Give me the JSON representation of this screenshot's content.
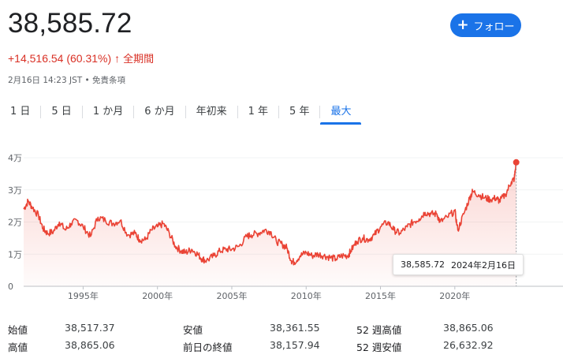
{
  "quote": {
    "price": "38,585.72",
    "change": "+14,516.54 (60.31%)",
    "change_arrow": "↑",
    "period": "全期間",
    "timestamp": "2月16日 14:23 JST • 免責条項",
    "follow_label": "フォロー",
    "follow_icon": "plus-icon"
  },
  "tabs": [
    {
      "label": "1 日",
      "active": false
    },
    {
      "label": "5 日",
      "active": false
    },
    {
      "label": "1 か月",
      "active": false
    },
    {
      "label": "6 か月",
      "active": false
    },
    {
      "label": "年初来",
      "active": false
    },
    {
      "label": "1 年",
      "active": false
    },
    {
      "label": "5 年",
      "active": false
    },
    {
      "label": "最大",
      "active": true
    }
  ],
  "tooltip": {
    "value": "38,585.72",
    "date": "2024年2月16日"
  },
  "chart_data": {
    "type": "area",
    "color": "#ea4335",
    "y_ticks": [
      {
        "value": 0,
        "label": "0"
      },
      {
        "value": 10000,
        "label": "1万"
      },
      {
        "value": 20000,
        "label": "2万"
      },
      {
        "value": 30000,
        "label": "3万"
      },
      {
        "value": 40000,
        "label": "4万"
      }
    ],
    "ylim": [
      0,
      40000
    ],
    "xlim": [
      1991.0,
      2024.2
    ],
    "x_ticks": [
      {
        "value": 1995,
        "label": "1995年"
      },
      {
        "value": 2000,
        "label": "2000年"
      },
      {
        "value": 2005,
        "label": "2005年"
      },
      {
        "value": 2010,
        "label": "2010年"
      },
      {
        "value": 2015,
        "label": "2015年"
      },
      {
        "value": 2020,
        "label": "2020年"
      }
    ],
    "x": [
      1991.0,
      1991.3,
      1991.6,
      1992.0,
      1992.3,
      1992.6,
      1993.0,
      1993.4,
      1993.8,
      1994.2,
      1994.6,
      1995.0,
      1995.5,
      1996.0,
      1996.5,
      1997.0,
      1997.5,
      1998.0,
      1998.5,
      1998.8,
      1999.2,
      1999.6,
      2000.0,
      2000.4,
      2000.8,
      2001.2,
      2001.6,
      2001.9,
      2002.3,
      2002.7,
      2003.0,
      2003.3,
      2003.8,
      2004.2,
      2004.6,
      2005.0,
      2005.5,
      2006.0,
      2006.3,
      2006.8,
      2007.2,
      2007.6,
      2008.0,
      2008.4,
      2008.7,
      2009.0,
      2009.2,
      2009.6,
      2010.0,
      2010.4,
      2010.8,
      2011.2,
      2011.6,
      2012.0,
      2012.4,
      2012.8,
      2013.0,
      2013.4,
      2013.8,
      2014.2,
      2014.6,
      2015.0,
      2015.5,
      2015.9,
      2016.3,
      2016.8,
      2017.2,
      2017.6,
      2018.0,
      2018.4,
      2018.8,
      2019.0,
      2019.5,
      2020.0,
      2020.2,
      2020.6,
      2021.0,
      2021.2,
      2021.6,
      2022.0,
      2022.4,
      2022.8,
      2023.0,
      2023.4,
      2023.8,
      2024.0,
      2024.13
    ],
    "values": [
      24000,
      26500,
      24500,
      22000,
      18000,
      16500,
      17000,
      20000,
      17500,
      19500,
      20500,
      18500,
      15500,
      21500,
      20500,
      19500,
      20500,
      16000,
      16500,
      14500,
      14500,
      17500,
      18500,
      19500,
      16500,
      12500,
      11000,
      10500,
      11500,
      10000,
      8500,
      8000,
      9500,
      11000,
      11500,
      11500,
      12500,
      15500,
      16000,
      16500,
      17500,
      17000,
      14000,
      13000,
      12000,
      8000,
      7500,
      9500,
      10500,
      9500,
      10000,
      9500,
      9000,
      8500,
      9500,
      9500,
      11000,
      14000,
      15000,
      14500,
      16000,
      18500,
      20000,
      17500,
      16500,
      18500,
      20000,
      21000,
      23000,
      22500,
      22500,
      20000,
      21500,
      23500,
      17500,
      22500,
      27500,
      29500,
      28500,
      27500,
      27000,
      27500,
      26500,
      28500,
      32500,
      33500,
      38585
    ]
  },
  "stats": {
    "rows": [
      [
        {
          "label": "始値",
          "value": "38,517.37"
        },
        {
          "label": "安値",
          "value": "38,361.55"
        },
        {
          "label": "52 週高値",
          "value": "38,865.06"
        }
      ],
      [
        {
          "label": "高値",
          "value": "38,865.06"
        },
        {
          "label": "前日の終値",
          "value": "38,157.94"
        },
        {
          "label": "52 週安値",
          "value": "26,632.92"
        }
      ]
    ]
  }
}
